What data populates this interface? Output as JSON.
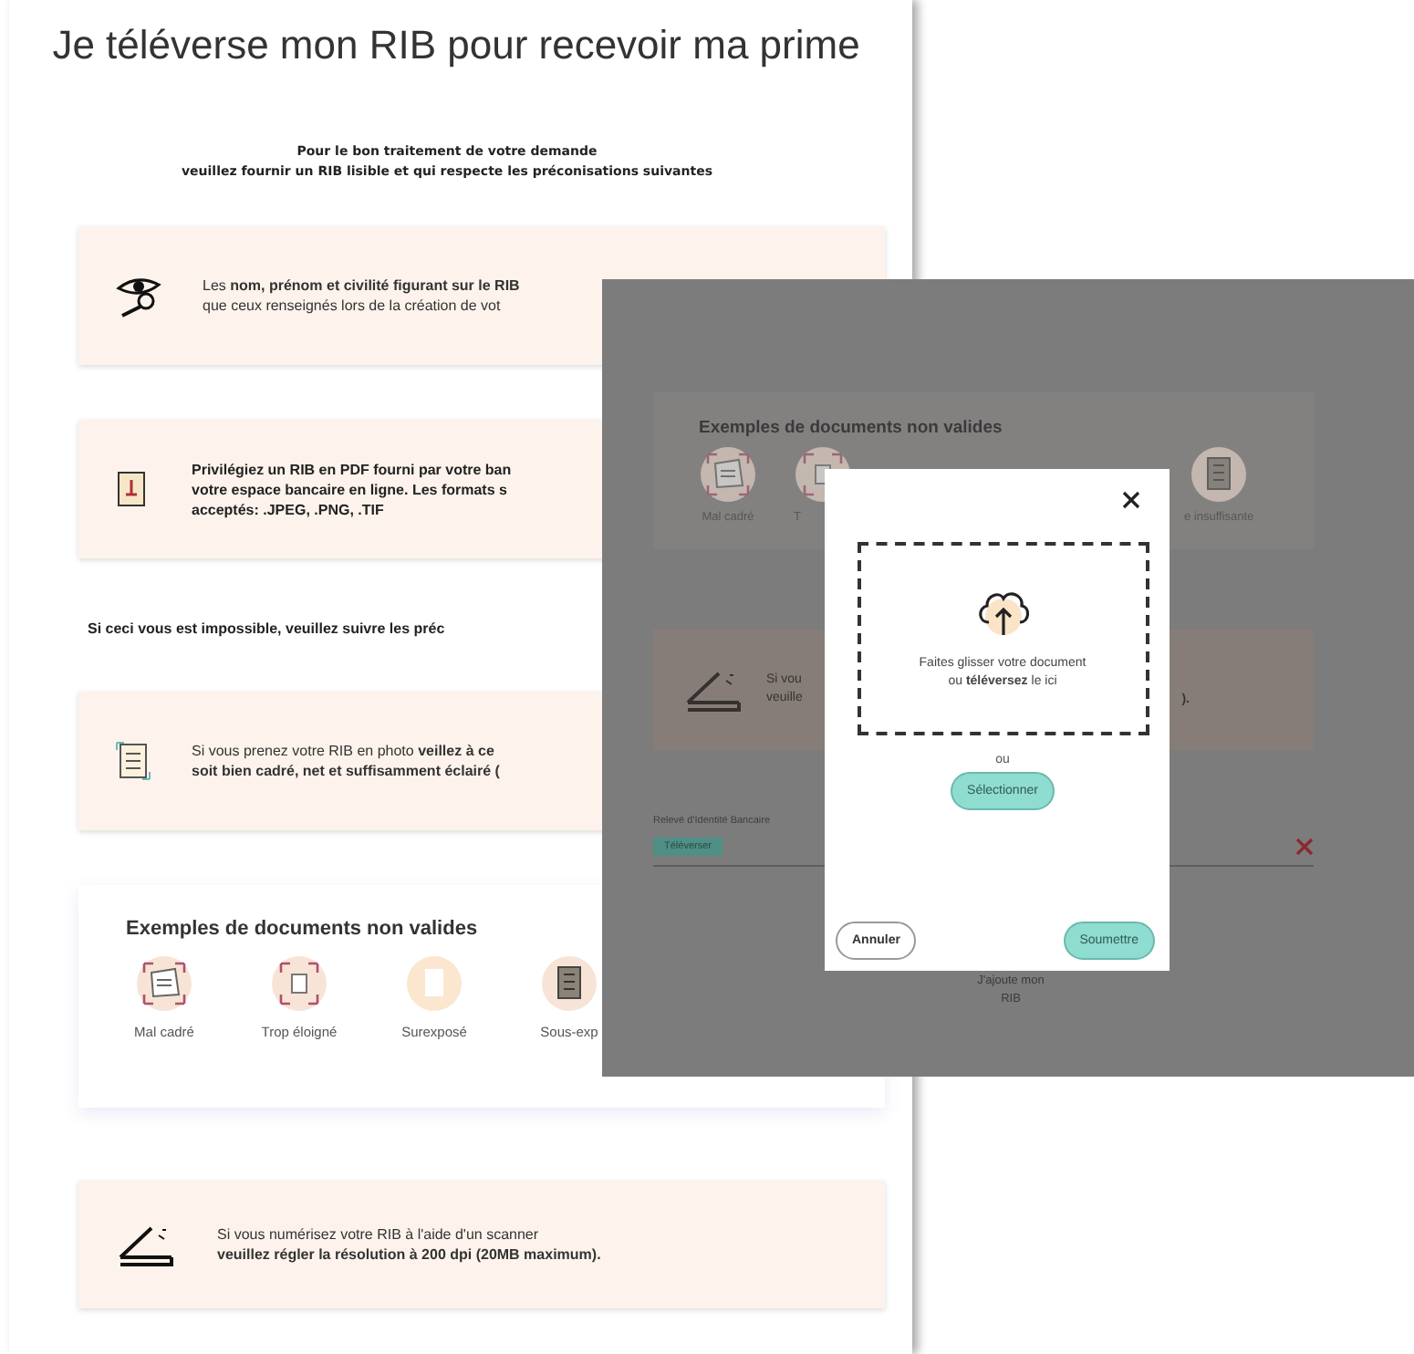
{
  "page": {
    "title": "Je téléverse mon RIB pour recevoir ma prime",
    "intro": [
      "Pour le bon traitement de votre demande",
      "veuillez fournir un RIB lisible et qui respecte les préconisations suivantes"
    ],
    "sections": [
      {
        "kind": "tip",
        "bold": false,
        "lines": [
          "Les **nom, prénom et civilité figurant sur le RIB**",
          "que ceux renseignés lors de la création de vot"
        ]
      },
      {
        "kind": "tip",
        "bold": true,
        "lines": [
          "Privilégiez un RIB en PDF fourni par votre ban",
          "votre espace bancaire en ligne. Les formats s",
          "acceptés: .JPEG, .PNG, .TIF"
        ]
      },
      {
        "kind": "note",
        "text": "Si ceci vous est impossible, veuillez suivre les préc"
      },
      {
        "kind": "tip",
        "bold": false,
        "lines": [
          "Si vous prenez votre RIB en photo **veillez à ce**",
          "**soit bien cadré, net et suffisamment éclairé (**"
        ]
      },
      {
        "kind": "examples",
        "title": "Exemples de documents non valides",
        "items": [
          {
            "label": "Mal cadré"
          },
          {
            "label": "Trop éloigné"
          },
          {
            "label": "Surexposé"
          },
          {
            "label": "Sous-exp"
          }
        ]
      },
      {
        "kind": "tip",
        "bold": false,
        "lines": [
          "Si vous numérisez votre RIB à l'aide d'un scanner",
          "**veuillez régler la résolution à 200 dpi (20MB maximum).**"
        ]
      }
    ]
  },
  "overlay": {
    "examples": {
      "title": "Exemples de documents non valides",
      "items": [
        {
          "label": "Mal cadré"
        },
        {
          "label": "T"
        },
        {
          "label": "e insuffisante"
        }
      ]
    },
    "scanner": {
      "lines": [
        "Si vou",
        "veuille"
      ],
      "tail": ")."
    },
    "field_label": "Relevé d'Identité Bancaire",
    "tag": "Téléverser",
    "button_lines": [
      "J'ajoute mon",
      "RIB"
    ],
    "modal": {
      "dropzone_lines": [
        "Faites glisser votre document",
        "ou **téléversez** le ici"
      ],
      "separator": "ou",
      "select_button": "Sélectionner",
      "cancel_button": "Annuler",
      "submit_button": "Soumettre"
    }
  }
}
